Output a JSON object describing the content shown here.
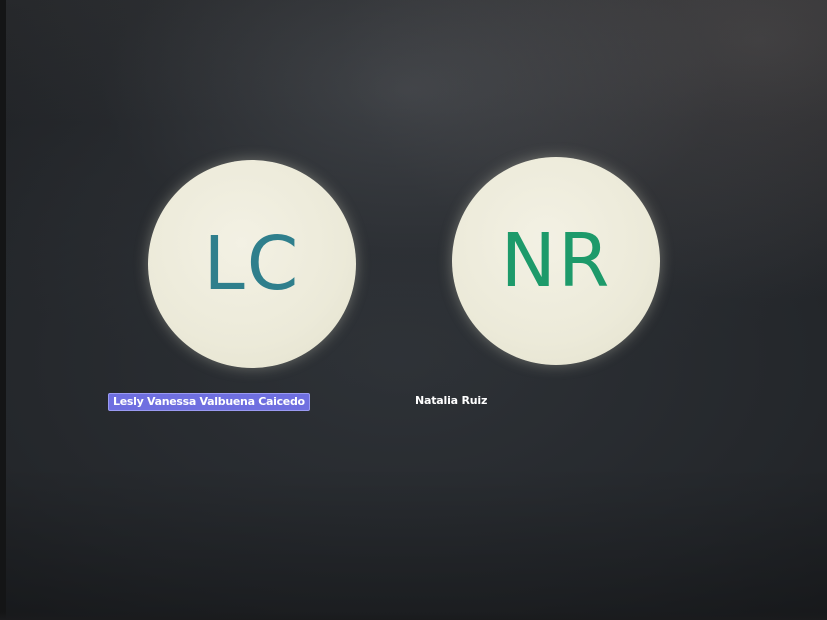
{
  "participants": [
    {
      "initials": "LC",
      "name": "Lesly Vanessa Valbuena Caicedo",
      "initials_color": "#2f7f8c",
      "highlighted": true
    },
    {
      "initials": "NR",
      "name": "Natalia Ruiz",
      "initials_color": "#1d9a6a",
      "highlighted": false
    }
  ],
  "colors": {
    "avatar_background": "#ecead9",
    "highlight_label": "#6f6fe0",
    "meeting_background": "#2a2d31"
  }
}
